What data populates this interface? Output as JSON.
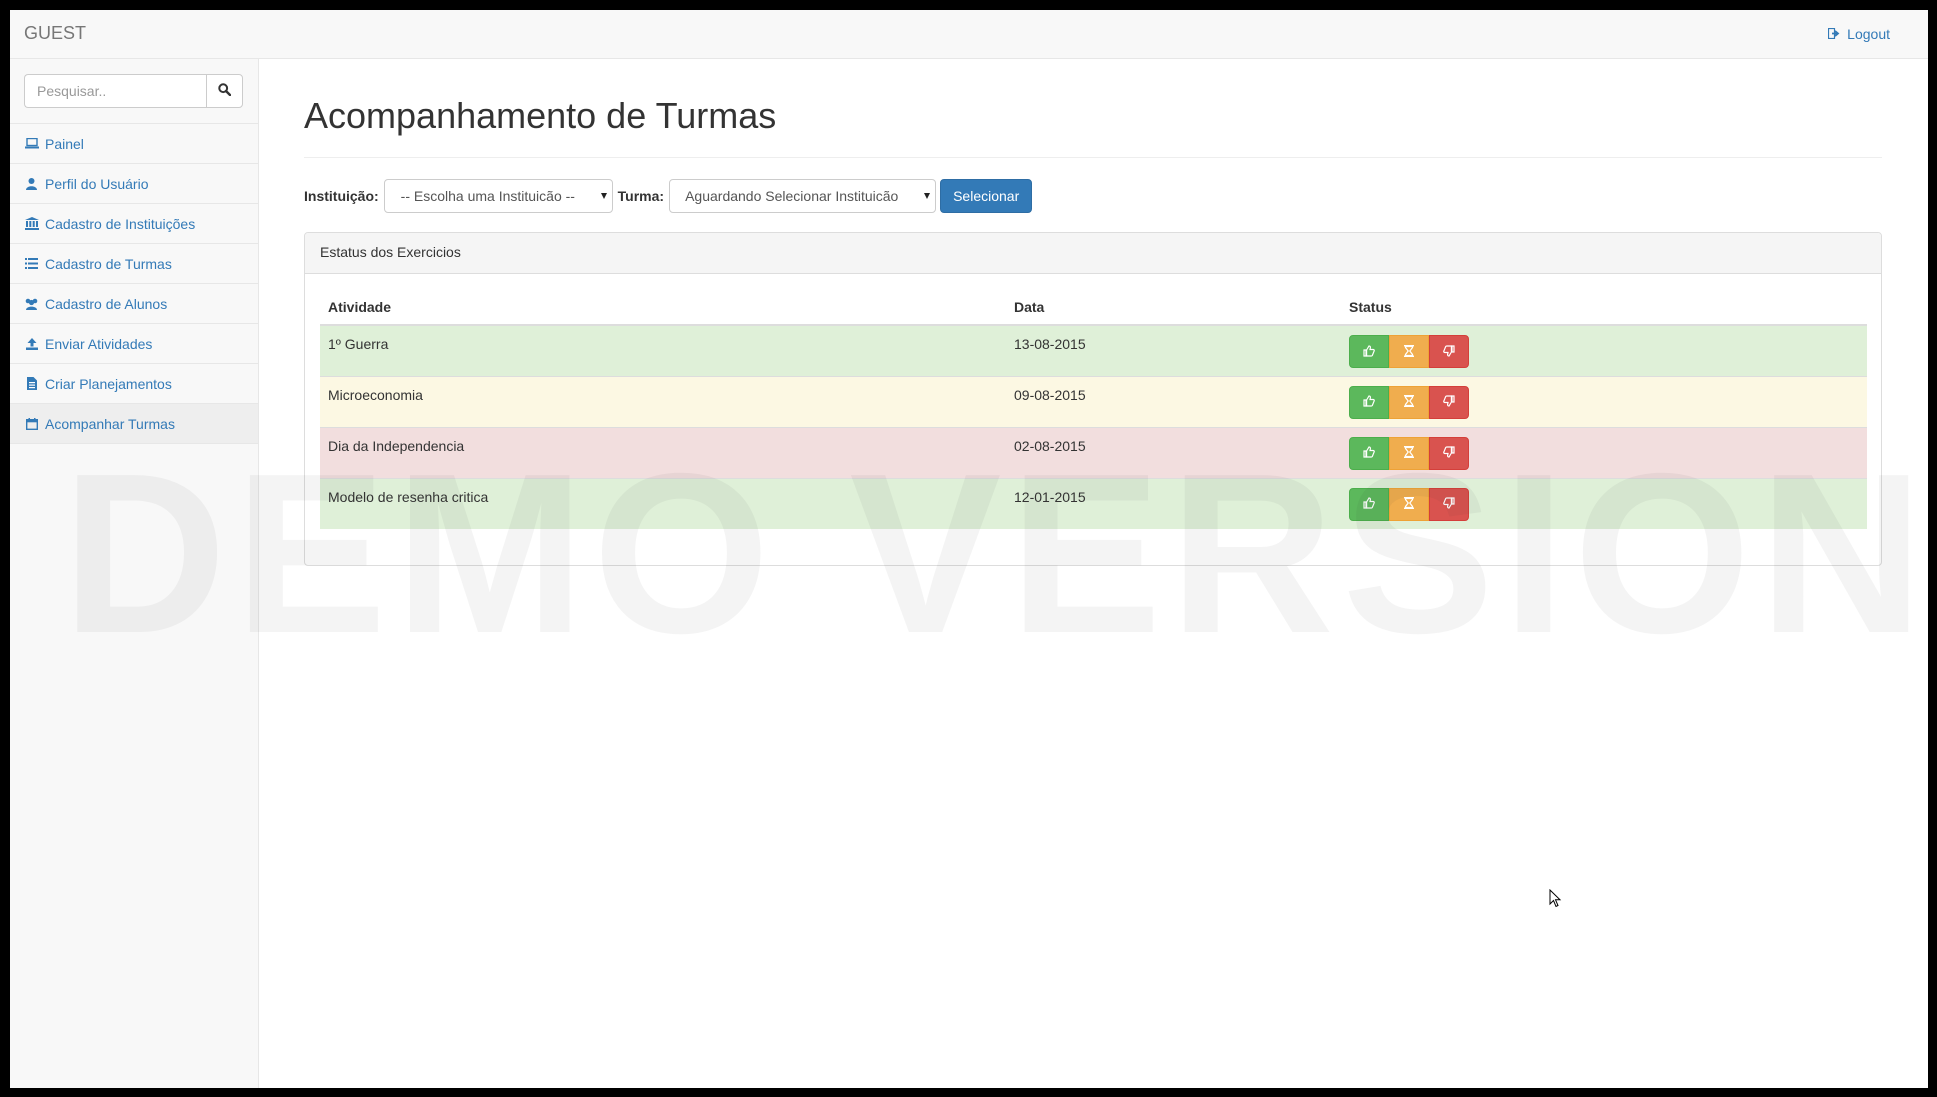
{
  "navbar": {
    "brand": "GUEST",
    "logout_label": "Logout"
  },
  "sidebar": {
    "search_placeholder": "Pesquisar..",
    "items": [
      {
        "label": "Painel",
        "icon": "laptop-icon"
      },
      {
        "label": "Perfil do Usuário",
        "icon": "user-icon"
      },
      {
        "label": "Cadastro de Instituições",
        "icon": "bank-icon"
      },
      {
        "label": "Cadastro de Turmas",
        "icon": "list-icon"
      },
      {
        "label": "Cadastro de Alunos",
        "icon": "users-icon"
      },
      {
        "label": "Enviar Atividades",
        "icon": "upload-icon"
      },
      {
        "label": "Criar Planejamentos",
        "icon": "file-icon"
      },
      {
        "label": "Acompanhar Turmas",
        "icon": "calendar-icon",
        "active": true
      }
    ]
  },
  "main": {
    "title": "Acompanhamento de Turmas",
    "filters": {
      "instituicao_label": "Instituição:",
      "instituicao_value": "-- Escolha uma Instituicão --",
      "turma_label": "Turma:",
      "turma_value": "Aguardando Selecionar Instituicão",
      "select_button": "Selecionar"
    },
    "panel": {
      "heading": "Estatus dos Exercicios",
      "columns": [
        "Atividade",
        "Data",
        "Status"
      ],
      "rows": [
        {
          "atividade": "1º Guerra",
          "data": "13-08-2015",
          "state": "success"
        },
        {
          "atividade": "Microeconomia",
          "data": "09-08-2015",
          "state": "warning"
        },
        {
          "atividade": "Dia da Independencia",
          "data": "02-08-2015",
          "state": "danger"
        },
        {
          "atividade": "Modelo de resenha critica",
          "data": "12-01-2015",
          "state": "success"
        }
      ]
    }
  },
  "watermark": "DEMO VERSION",
  "colors": {
    "primary": "#337ab7",
    "success": "#5cb85c",
    "warning": "#f0ad4e",
    "danger": "#d9534f",
    "row_success": "#dff0d8",
    "row_warning": "#fcf8e3",
    "row_danger": "#f2dede"
  }
}
